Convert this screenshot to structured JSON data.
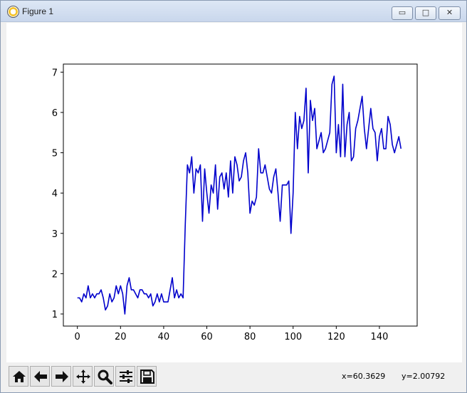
{
  "window": {
    "title": "Figure 1",
    "minimize_glyph": "▭",
    "maximize_glyph": "□",
    "close_glyph": "✕"
  },
  "toolbar": {
    "tools": [
      {
        "name": "home-icon"
      },
      {
        "name": "back-icon"
      },
      {
        "name": "forward-icon"
      },
      {
        "name": "pan-icon"
      },
      {
        "name": "zoom-icon"
      },
      {
        "name": "configure-subplots-icon"
      },
      {
        "name": "save-icon"
      }
    ],
    "coord_x": "x=60.3629",
    "coord_y": "y=2.00792"
  },
  "chart_data": {
    "type": "line",
    "color": "#0000cc",
    "xlim": [
      -6.5,
      157.5
    ],
    "ylim": [
      0.7,
      7.2
    ],
    "xticks": [
      0,
      20,
      40,
      60,
      80,
      100,
      120,
      140
    ],
    "yticks": [
      1,
      2,
      3,
      4,
      5,
      6,
      7
    ],
    "grid": false,
    "series": [
      {
        "values": [
          1.4,
          1.4,
          1.3,
          1.5,
          1.4,
          1.7,
          1.4,
          1.5,
          1.4,
          1.5,
          1.5,
          1.6,
          1.4,
          1.1,
          1.2,
          1.5,
          1.3,
          1.4,
          1.7,
          1.5,
          1.7,
          1.5,
          1.0,
          1.7,
          1.9,
          1.6,
          1.6,
          1.5,
          1.4,
          1.6,
          1.6,
          1.5,
          1.5,
          1.4,
          1.5,
          1.2,
          1.3,
          1.5,
          1.3,
          1.5,
          1.3,
          1.3,
          1.3,
          1.6,
          1.9,
          1.4,
          1.6,
          1.4,
          1.5,
          1.4,
          3.2,
          4.7,
          4.5,
          4.9,
          4.0,
          4.6,
          4.5,
          4.7,
          3.3,
          4.6,
          4.0,
          3.5,
          4.2,
          4.0,
          4.7,
          3.6,
          4.4,
          4.5,
          4.1,
          4.5,
          3.9,
          4.8,
          4.0,
          4.9,
          4.7,
          4.3,
          4.4,
          4.8,
          5.0,
          4.5,
          3.5,
          3.8,
          3.7,
          3.9,
          5.1,
          4.5,
          4.5,
          4.7,
          4.4,
          4.1,
          4.0,
          4.4,
          4.6,
          4.0,
          3.3,
          4.2,
          4.2,
          4.2,
          4.3,
          3.0,
          4.0,
          6.0,
          5.1,
          5.9,
          5.6,
          5.8,
          6.6,
          4.5,
          6.3,
          5.8,
          6.1,
          5.1,
          5.3,
          5.5,
          5.0,
          5.1,
          5.3,
          5.5,
          6.7,
          6.9,
          5.0,
          5.7,
          4.9,
          6.7,
          4.9,
          5.7,
          6.0,
          4.8,
          4.9,
          5.6,
          5.8,
          6.1,
          6.4,
          5.6,
          5.1,
          5.6,
          6.1,
          5.6,
          5.5,
          4.8,
          5.4,
          5.6,
          5.1,
          5.1,
          5.9,
          5.7,
          5.2,
          5.0,
          5.2,
          5.4,
          5.1
        ]
      }
    ]
  }
}
